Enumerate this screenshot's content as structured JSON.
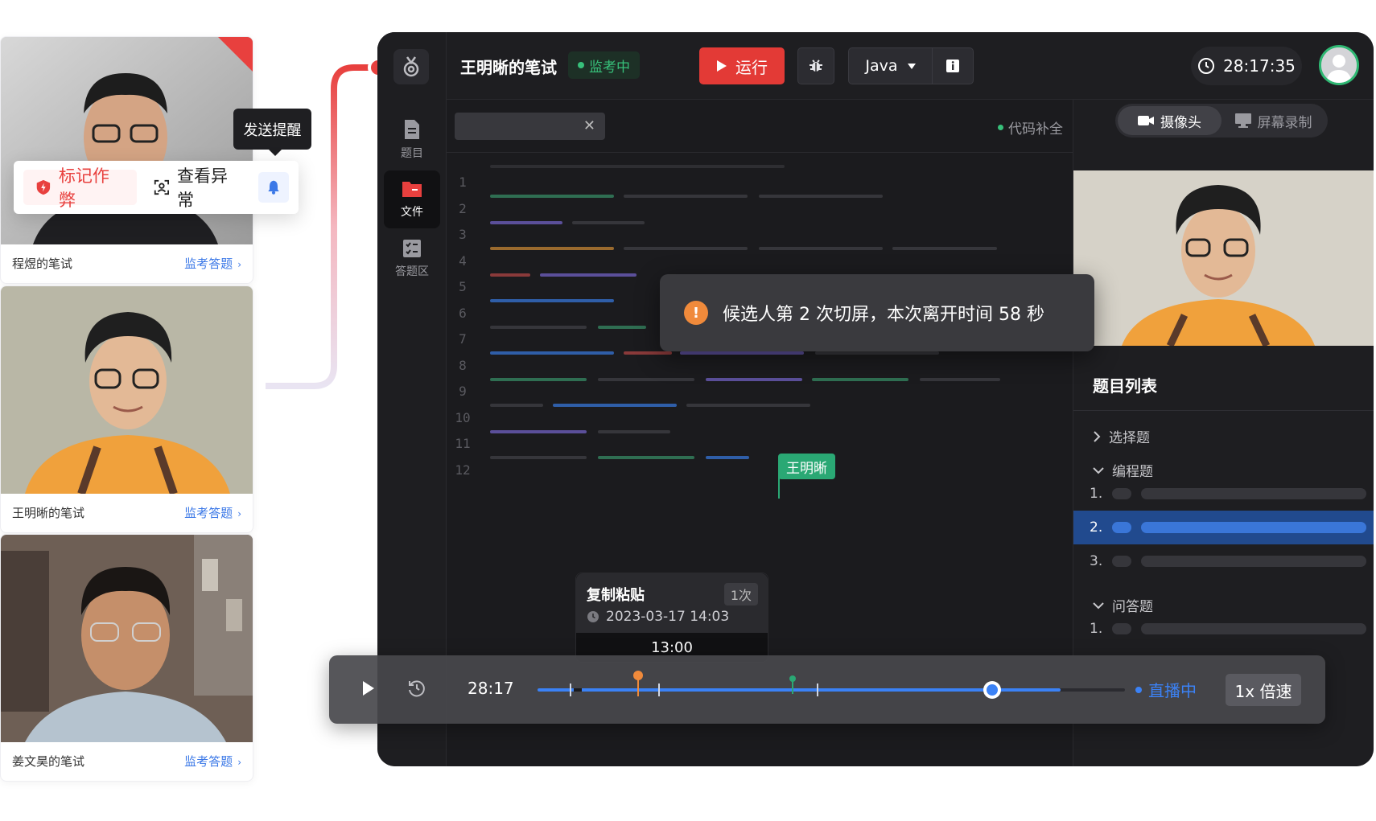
{
  "cards": [
    {
      "name": "程煜的笔试",
      "link": "监考答题",
      "arrow": "›"
    },
    {
      "name": "王明晰的笔试",
      "link": "监考答题",
      "arrow": "›"
    },
    {
      "name": "姜文昊的笔试",
      "link": "监考答题",
      "arrow": "›"
    }
  ],
  "actions": {
    "flag": "标记作弊",
    "view": "查看异常",
    "tooltip": "发送提醒"
  },
  "header": {
    "title": "王明晰的笔试",
    "status": "监考中",
    "run": "运行",
    "language": "Java",
    "timer": "28:17:35"
  },
  "sidebar": {
    "items": [
      {
        "label": "题目",
        "icon": "document-icon"
      },
      {
        "label": "文件",
        "icon": "folder-icon"
      },
      {
        "label": "答题区",
        "icon": "checklist-icon"
      }
    ]
  },
  "editor": {
    "autocomplete": "代码补全",
    "close_symbol": "✕",
    "line_numbers": [
      "1",
      "2",
      "3",
      "4",
      "5",
      "6",
      "7",
      "8",
      "9",
      "10",
      "11",
      "12"
    ],
    "cursor_user": "王明晰"
  },
  "toast": {
    "icon": "!",
    "text": "候选人第 2 次切屏，本次离开时间 58 秒"
  },
  "right_panel": {
    "tabs": [
      "摄像头",
      "屏幕录制"
    ],
    "question_list_title": "题目列表",
    "groups": [
      {
        "label": "选择题",
        "expanded": false
      },
      {
        "label": "编程题",
        "expanded": true,
        "items": [
          "1.",
          "2.",
          "3."
        ]
      },
      {
        "label": "问答题",
        "expanded": true,
        "items": [
          "1."
        ]
      }
    ]
  },
  "event": {
    "title": "复制粘贴",
    "count": "1次",
    "time": "2023-03-17 14:03",
    "position": "13:00"
  },
  "player": {
    "time": "28:17",
    "live": "直播中",
    "speed": "1x 倍速",
    "progress": 0.89
  },
  "colors": {
    "accent": "#3b82f6",
    "danger": "#e33a36",
    "success": "#2aa874",
    "warning": "#f08a3b"
  }
}
